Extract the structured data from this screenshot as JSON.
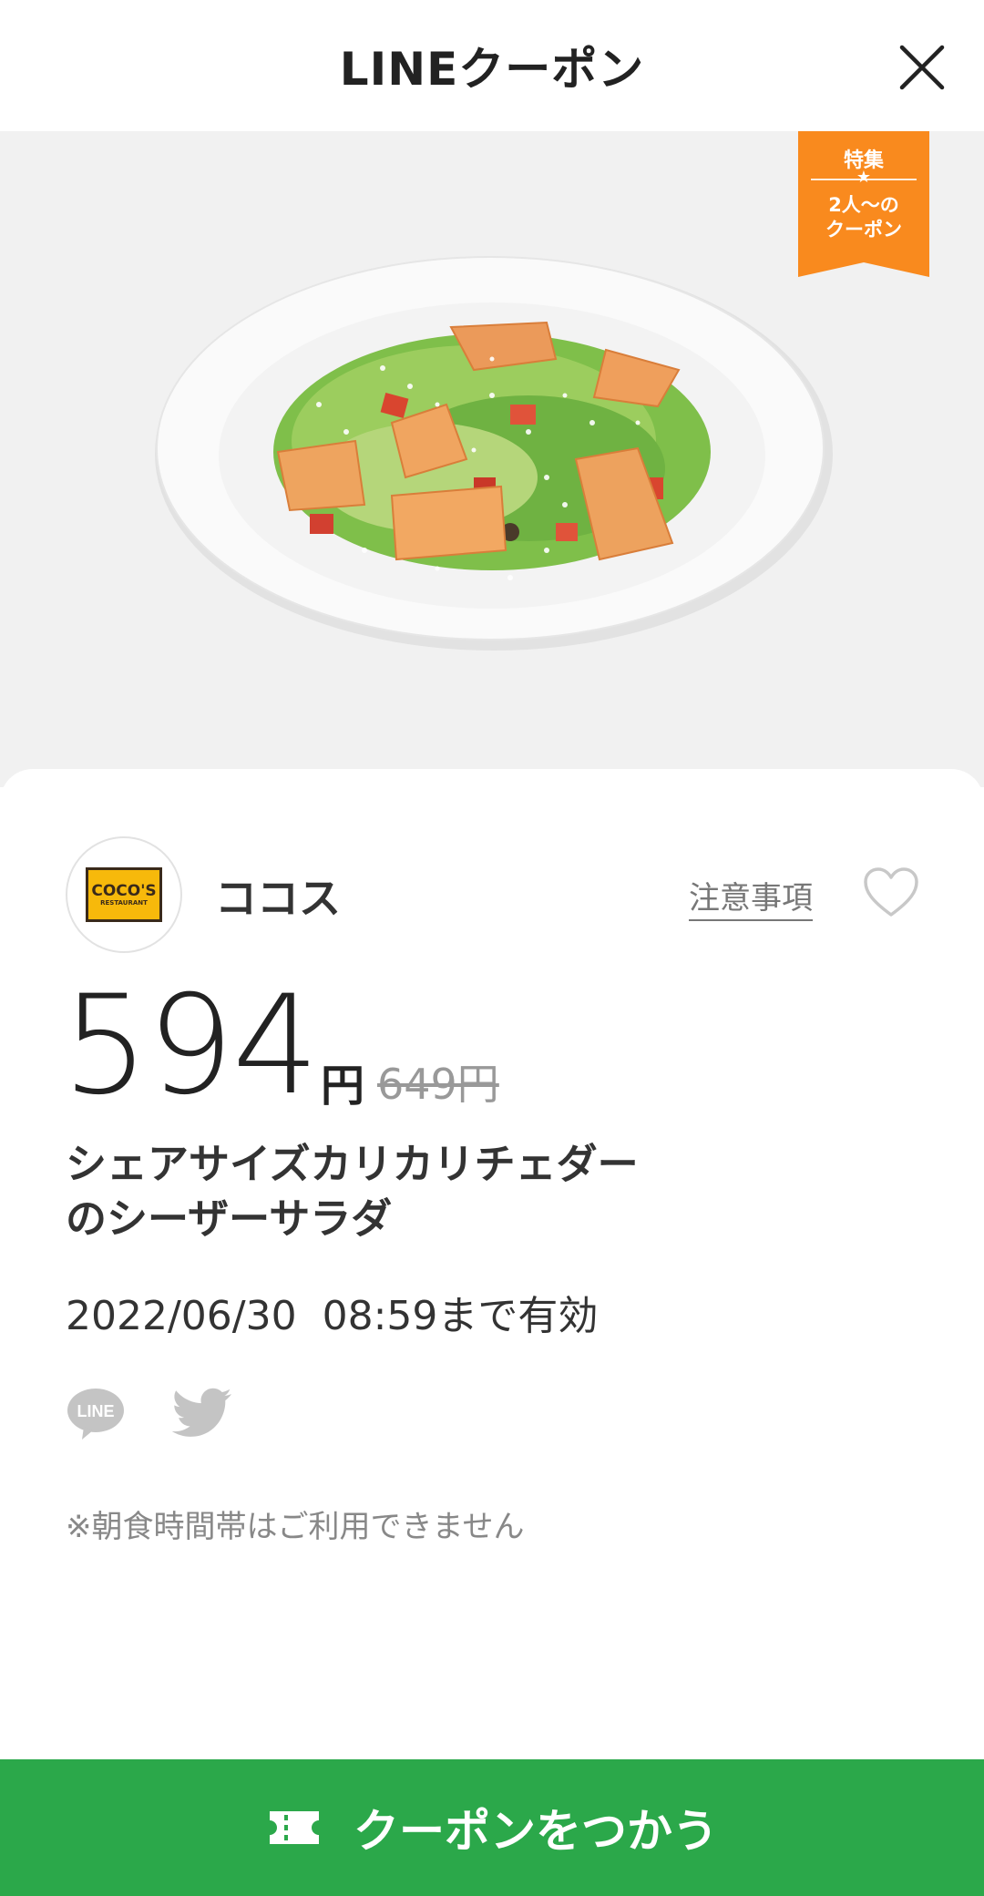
{
  "header": {
    "title": "LINEクーポン"
  },
  "badge": {
    "line1": "特集",
    "line2": "2人〜の",
    "line3": "クーポン"
  },
  "shop": {
    "name": "ココス",
    "logo_main": "COCO'S",
    "logo_sub": "RESTAURANT"
  },
  "notice_label": "注意事項",
  "price": {
    "value": "594",
    "unit": "円",
    "original": "649円"
  },
  "product": {
    "name_line1": "シェアサイズカリカリチェダー",
    "name_line2": "のシーザーサラダ"
  },
  "validity": "2022/06/30  08:59まで有効",
  "note": "※朝食時間帯はご利用できません",
  "cta_label": "クーポンをつかう",
  "colors": {
    "accent": "#2ba84a",
    "badge": "#f98a1e",
    "text": "#333333"
  },
  "icons": [
    "close-icon",
    "heart-icon",
    "line-share-icon",
    "twitter-icon",
    "ticket-icon"
  ]
}
